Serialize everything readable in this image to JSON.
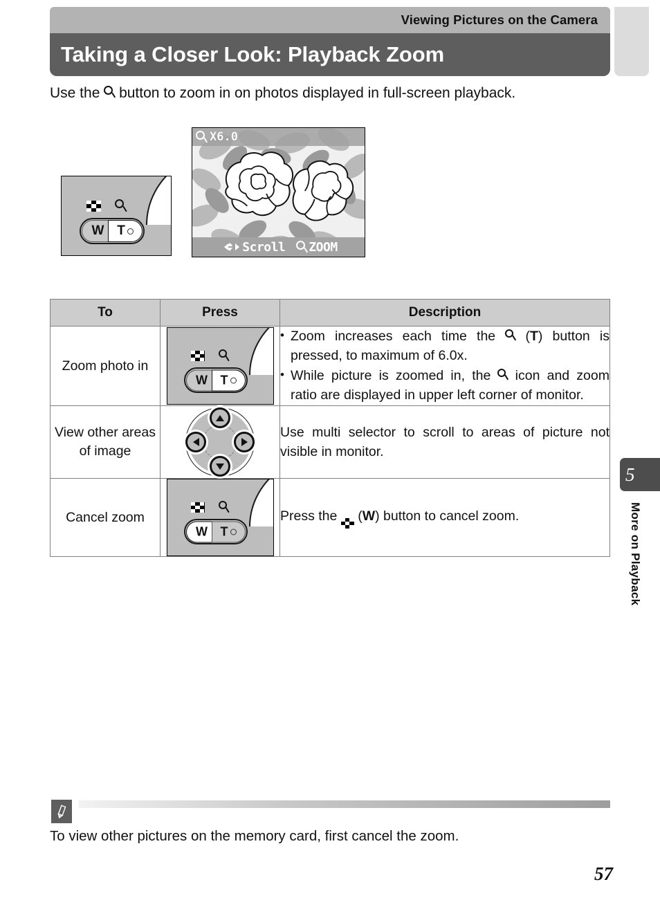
{
  "header": {
    "running_head": "Viewing Pictures on the Camera",
    "chapter_title": "Taking a Closer Look: Playback Zoom"
  },
  "intro": {
    "before_icon": "Use the",
    "icon": "magnifier-icon",
    "after_icon": "button to zoom in on photos displayed in full-screen playback."
  },
  "figure": {
    "camera_control": {
      "w_label": "W",
      "t_label": "T",
      "w_icon": "thumbnail-icon",
      "t_icon": "magnifier-icon",
      "active_button": "T"
    },
    "monitor": {
      "zoom_ratio": "X6.0",
      "zoom_icon": "magnifier-icon",
      "scroll_label": "Scroll",
      "scroll_icon": "dpad-arrows-icon",
      "zoom_label": "ZOOM",
      "zoom_label_icon": "magnifier-icon"
    }
  },
  "table": {
    "headers": [
      "To",
      "Press",
      "Description"
    ],
    "rows": [
      {
        "to": "Zoom photo in",
        "press_type": "zoom-rocker",
        "press_active": "T",
        "desc_bullets": [
          "Zoom increases each time the Q (T) button is pressed, to maximum of 6.0x.",
          "While picture is zoomed in, the Q icon and zoom ratio are displayed in upper left corner of monitor."
        ],
        "desc_b1_p1": "Zoom increases each time the",
        "desc_b1_icon": "magnifier-icon",
        "desc_b1_p2": "(",
        "desc_b1_t": "T",
        "desc_b1_p3": ") button is pressed, to maximum of 6.0x.",
        "desc_b2_p1": "While picture is zoomed in, the",
        "desc_b2_icon": "magnifier-icon",
        "desc_b2_p2": "icon and zoom ratio are displayed in upper left corner of monitor."
      },
      {
        "to": "View other areas of image",
        "press_type": "multi-selector",
        "desc": "Use multi selector to scroll to areas of picture not visible in monitor."
      },
      {
        "to": "Cancel zoom",
        "press_type": "zoom-rocker",
        "press_active": "W",
        "desc_p1": "Press the",
        "desc_icon": "thumbnail-icon",
        "desc_p2": "(",
        "desc_w": "W",
        "desc_p3": ") button to cancel zoom."
      }
    ]
  },
  "side_tab": {
    "chapter_number": "5",
    "chapter_label": "More on Playback"
  },
  "note": {
    "icon": "pencil-icon",
    "text": "To view other pictures on the memory card, first cancel the zoom."
  },
  "folio": {
    "page_number": "57"
  },
  "colors": {
    "running_head_bg": "#b3b3b3",
    "title_bar_bg": "#5e5e5e",
    "table_header_bg": "#cdcdcd",
    "table_border": "#808080",
    "camera_body": "#bdbdbd",
    "lcd_bar": "#a3a3a3",
    "side_tab_bg": "#4d4d4d"
  }
}
